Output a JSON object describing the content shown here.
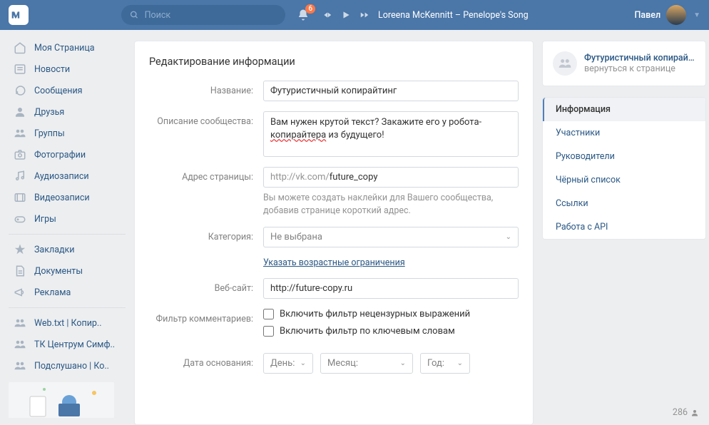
{
  "header": {
    "search_placeholder": "Поиск",
    "notif_count": "6",
    "track": "Loreena McKennitt – Penelope's Song",
    "user_name": "Павел"
  },
  "sidebar": {
    "items": [
      {
        "label": "Моя Страница"
      },
      {
        "label": "Новости"
      },
      {
        "label": "Сообщения"
      },
      {
        "label": "Друзья"
      },
      {
        "label": "Группы"
      },
      {
        "label": "Фотографии"
      },
      {
        "label": "Аудиозаписи"
      },
      {
        "label": "Видеозаписи"
      },
      {
        "label": "Игры"
      }
    ],
    "items2": [
      {
        "label": "Закладки"
      },
      {
        "label": "Документы"
      },
      {
        "label": "Реклама"
      }
    ],
    "items3": [
      {
        "label": "Web.txt | Копир.."
      },
      {
        "label": "ТК Центрум Симф.."
      },
      {
        "label": "Подслушано | Ко.."
      }
    ]
  },
  "main": {
    "title": "Редактирование информации",
    "labels": {
      "name": "Название:",
      "desc": "Описание сообщества:",
      "addr": "Адрес страницы:",
      "cat": "Категория:",
      "site": "Веб-сайт:",
      "filter": "Фильтр комментариев:",
      "date": "Дата основания:"
    },
    "name_value": "Футуристичный копирайтинг",
    "desc_value_pre": "Вам нужен крутой текст? Закажите его у робота-",
    "desc_value_ul": "копирайтера",
    "desc_value_post": " из будущего!",
    "addr_prefix": "http://vk.com/",
    "addr_value": "future_copy",
    "addr_hint": "Вы можете создать наклейки для Вашего сообщества, добавив странице короткий адрес.",
    "cat_value": "Не выбрана",
    "age_link": "Указать возрастные ограничения",
    "site_value": "http://future-copy.ru",
    "filter1_label": "Включить фильтр нецензурных выражений",
    "filter2_label": "Включить фильтр по ключевым словам",
    "day_label": "День:",
    "month_label": "Месяц:",
    "year_label": "Год:"
  },
  "right": {
    "group_name": "Футуристичный копирай…",
    "back_link": "вернуться к странице",
    "menu": [
      {
        "label": "Информация",
        "active": true
      },
      {
        "label": "Участники"
      },
      {
        "label": "Руководители"
      },
      {
        "label": "Чёрный список"
      },
      {
        "label": "Ссылки"
      },
      {
        "label": "Работа с API"
      }
    ]
  },
  "footer_count": "286"
}
